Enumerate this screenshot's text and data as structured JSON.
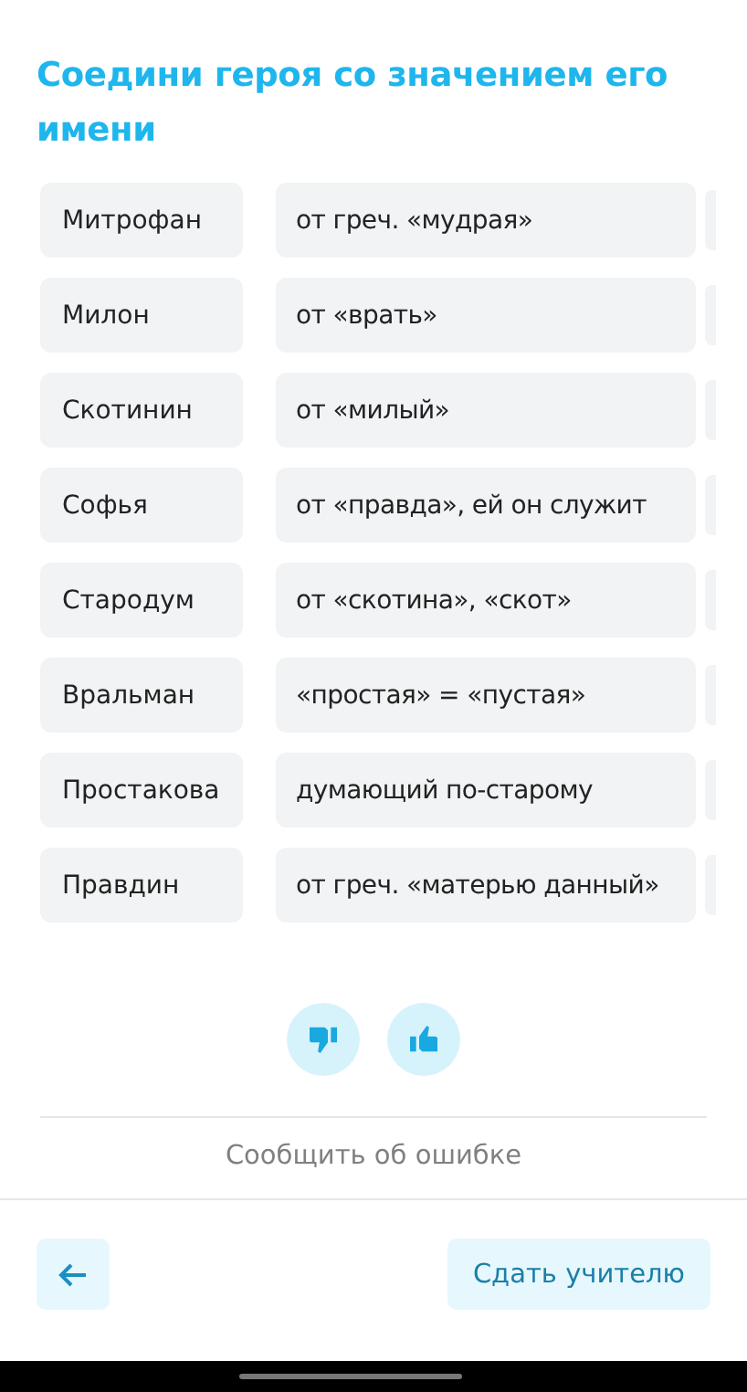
{
  "title": "Соедини героя со значением его имени",
  "pairs": [
    {
      "name": "Митрофан",
      "meaning": "от греч. «мудрая»"
    },
    {
      "name": "Милон",
      "meaning": "от «врать»"
    },
    {
      "name": "Скотинин",
      "meaning": "от «милый»"
    },
    {
      "name": "Софья",
      "meaning": "от «правда», ей он служит"
    },
    {
      "name": "Стародум",
      "meaning": "от «скотина», «скот»"
    },
    {
      "name": "Вральман",
      "meaning": "«простая» = «пустая»"
    },
    {
      "name": "Простакова",
      "meaning": "думающий по-старому"
    },
    {
      "name": "Правдин",
      "meaning": "от греч. «матерью данный»"
    }
  ],
  "report": "Сообщить об ошибке",
  "submit": "Сдать учителю"
}
